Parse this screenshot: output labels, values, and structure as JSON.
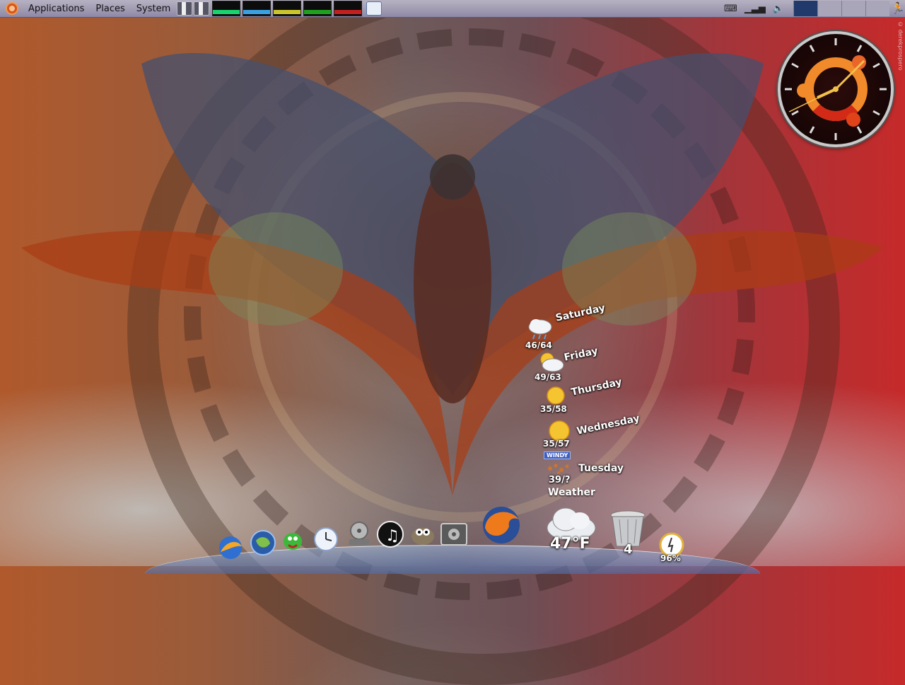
{
  "top_panel": {
    "menus": [
      "Applications",
      "Places",
      "System"
    ],
    "monitor_colors": [
      "#19d36c",
      "#3aa0e0",
      "#c9c52a",
      "#1fa11f",
      "#c21f1f"
    ],
    "icons": [
      "ubuntu-logo-icon",
      "cpu-freq-icon",
      "cpu-freq-icon",
      "weather-icon",
      "keyboard-icon",
      "network-signal-icon",
      "volume-icon",
      "run-icon"
    ],
    "workspaces": 4,
    "active_workspace": 1
  },
  "credit": "© derekprospero",
  "weather": {
    "title": "Weather",
    "current_temp": "47°F",
    "forecast": [
      {
        "day": "Saturday",
        "temp": "46/64",
        "icon": "rain-cloud-icon"
      },
      {
        "day": "Friday",
        "temp": "49/63",
        "icon": "partly-cloudy-icon"
      },
      {
        "day": "Thursday",
        "temp": "35/58",
        "icon": "sun-icon"
      },
      {
        "day": "Wednesday",
        "temp": "35/57",
        "icon": "sun-icon"
      },
      {
        "day": "Tuesday",
        "temp": "39/?",
        "icon": "windy-icon",
        "badge": "WINDY"
      }
    ]
  },
  "dock": {
    "trash_count": "4",
    "battery_percent": "96%",
    "items": [
      "thunderbird-icon",
      "globe-browser-icon",
      "pidgin-icon",
      "clock-app-icon",
      "film-reel-icon",
      "music-player-icon",
      "gimp-icon",
      "system-settings-icon",
      "firefox-icon",
      "weather-cloud-icon",
      "trash-icon",
      "battery-gauge-icon"
    ]
  }
}
